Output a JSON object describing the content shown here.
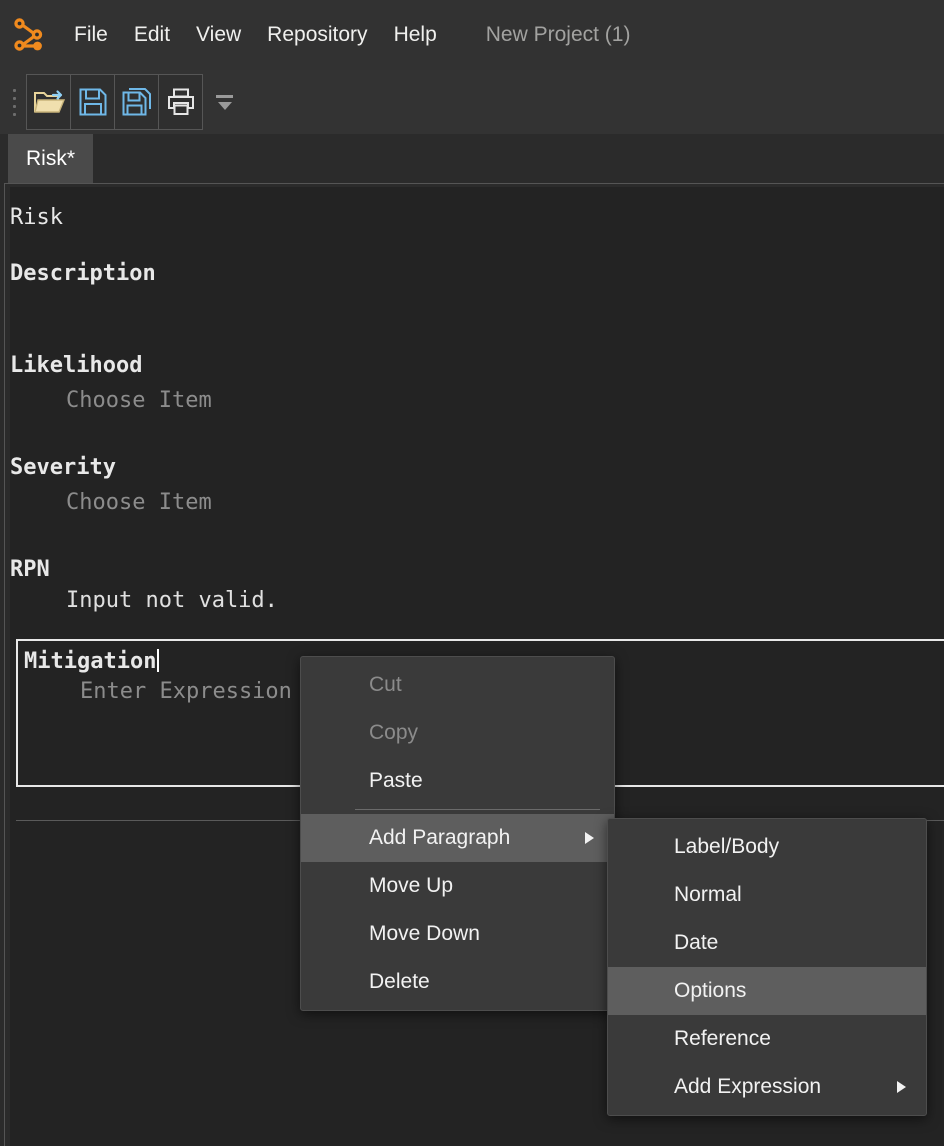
{
  "app": {
    "logo_icon": "node-graph-logo-icon",
    "accent_color": "#f08a1e",
    "window_bg": "#2b2b2b"
  },
  "menubar": {
    "items": [
      {
        "label": "File"
      },
      {
        "label": "Edit"
      },
      {
        "label": "View"
      },
      {
        "label": "Repository"
      },
      {
        "label": "Help"
      }
    ],
    "project_label": "New Project (1)"
  },
  "toolbar": {
    "buttons": [
      {
        "icon": "open-folder-icon",
        "name": "open-button"
      },
      {
        "icon": "save-icon",
        "name": "save-button"
      },
      {
        "icon": "save-as-icon",
        "name": "save-as-button"
      },
      {
        "icon": "print-icon",
        "name": "print-button"
      }
    ],
    "overflow_icon": "toolbar-overflow-caret-icon"
  },
  "tabs": [
    {
      "label": "Risk*",
      "active": true
    }
  ],
  "document": {
    "title": "Risk",
    "paragraphs": [
      {
        "label": "Description",
        "value": "",
        "bold": true
      },
      {
        "label": "Likelihood",
        "value": "Choose Item",
        "bold": true
      },
      {
        "label": "Severity",
        "value": "Choose Item",
        "bold": true
      },
      {
        "label": "RPN",
        "value": "Input not valid.",
        "bold": true
      },
      {
        "label": "Mitigation",
        "value": "Enter Expression",
        "bold": true,
        "focused": true
      }
    ]
  },
  "context_menu": {
    "items": [
      {
        "label": "Cut",
        "disabled": true,
        "highlighted": false,
        "submenu": false
      },
      {
        "label": "Copy",
        "disabled": true,
        "highlighted": false,
        "submenu": false
      },
      {
        "label": "Paste",
        "disabled": false,
        "highlighted": false,
        "submenu": false
      },
      {
        "label": "Add Paragraph",
        "disabled": false,
        "highlighted": true,
        "submenu": true
      },
      {
        "label": "Move Up",
        "disabled": false,
        "highlighted": false,
        "submenu": false
      },
      {
        "label": "Move Down",
        "disabled": false,
        "highlighted": false,
        "submenu": false
      },
      {
        "label": "Delete",
        "disabled": false,
        "highlighted": false,
        "submenu": false
      }
    ]
  },
  "submenu": {
    "items": [
      {
        "label": "Label/Body",
        "highlighted": false,
        "submenu": false
      },
      {
        "label": "Normal",
        "highlighted": false,
        "submenu": false
      },
      {
        "label": "Date",
        "highlighted": false,
        "submenu": false
      },
      {
        "label": "Options",
        "highlighted": true,
        "submenu": false
      },
      {
        "label": "Reference",
        "highlighted": false,
        "submenu": false
      },
      {
        "label": "Add Expression",
        "highlighted": false,
        "submenu": true
      }
    ]
  }
}
